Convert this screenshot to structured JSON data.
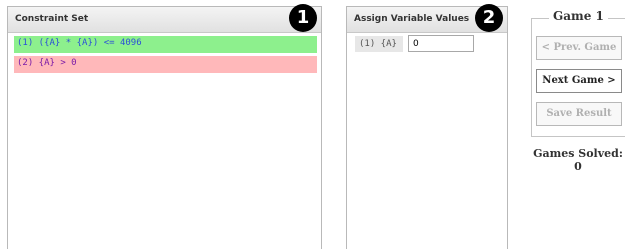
{
  "constraint_panel": {
    "title": "Constraint Set",
    "badge": "1",
    "constraints": [
      {
        "text": "(1) ({A} * {A}) <= 4096",
        "status": "satisfied",
        "color": "#8df08d"
      },
      {
        "text": "(2) {A} > 0",
        "status": "violated",
        "color": "#ffb8ba"
      }
    ]
  },
  "assign_panel": {
    "title": "Assign Variable Values",
    "badge": "2",
    "variables": [
      {
        "label": "(1) {A}",
        "value": "0"
      }
    ]
  },
  "game": {
    "title": "Game 1",
    "prev_label": "< Prev. Game",
    "next_label": "Next Game >",
    "save_label": "Save Result",
    "solved_label": "Games Solved:",
    "solved_count": "0"
  }
}
